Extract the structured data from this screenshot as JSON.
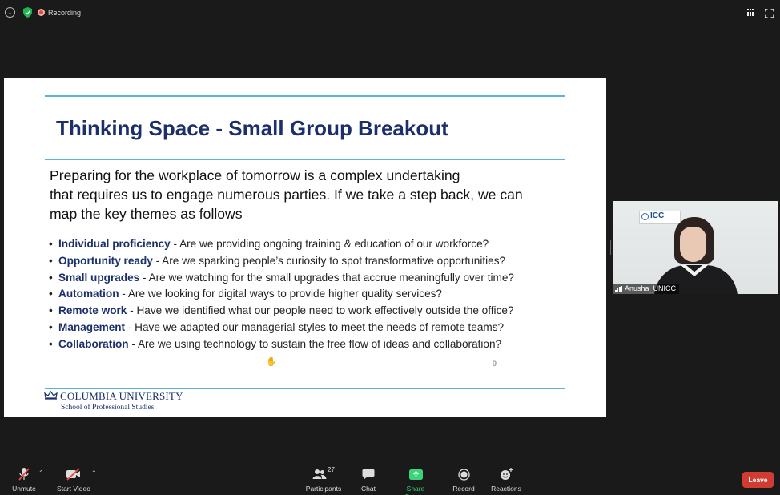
{
  "topbar": {
    "recording_label": "Recording"
  },
  "slide": {
    "title": "Thinking Space - Small Group Breakout",
    "intro": "Preparing for the workplace of tomorrow is a complex undertaking\nthat  requires us to engage numerous parties. If we take a step back, we can\nmap the key themes as follows",
    "bullets": [
      {
        "term": "Individual proficiency",
        "text": " - Are we providing ongoing training & education of our workforce?"
      },
      {
        "term": "Opportunity ready",
        "text": " - Are we sparking people’s curiosity to spot transformative opportunities?"
      },
      {
        "term": "Small upgrades",
        "text": " - Are we watching for the small upgrades that accrue meaningfully over time?"
      },
      {
        "term": "Automation",
        "text": " - Are we looking for digital ways to provide higher quality services?"
      },
      {
        "term": "Remote work",
        "text": " - Have we identified what our people need to work effectively outside the office?"
      },
      {
        "term": "Management",
        "text": " - Have we adapted our managerial styles to meet the needs of remote teams?"
      },
      {
        "term": "Collaboration",
        "text": " - Are we using technology to sustain the free flow of ideas and collaboration?"
      }
    ],
    "page_number": "9",
    "logo": {
      "university": "COLUMBIA UNIVERSITY",
      "school": "School of Professional Studies"
    }
  },
  "video": {
    "background_logo_text": "ICC",
    "participant_name": "Anusha_UNICC"
  },
  "toolbar": {
    "unmute_label": "Unmute",
    "start_video_label": "Start Video",
    "participants_label": "Participants",
    "participants_count": "27",
    "chat_label": "Chat",
    "share_screen_label": "Share Screen",
    "record_label": "Record",
    "reactions_label": "Reactions",
    "leave_label": "Leave"
  },
  "colors": {
    "title_navy": "#1b2f6b",
    "rule_blue": "#5bb3d9",
    "share_green": "#39d47a",
    "leave_red": "#d13b32",
    "recording_red": "#e0483a"
  }
}
